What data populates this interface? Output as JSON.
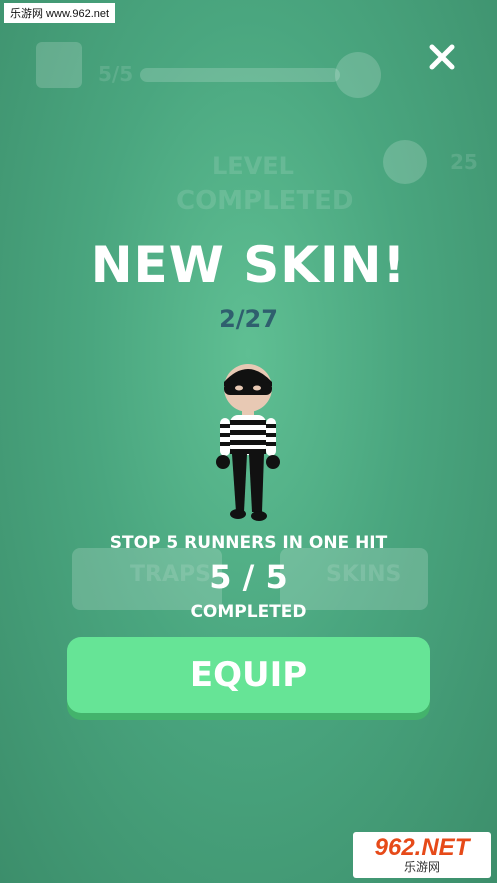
{
  "watermark_top": "乐游网 www.962.net",
  "background_hud": {
    "progress_text": "5/5",
    "level_line1": "LEVEL",
    "level_line2": "COMPLETED",
    "coins": "25",
    "traps_label": "TRAPS",
    "skins_label": "SKINS"
  },
  "modal": {
    "title": "NEW SKIN!",
    "counter": "2/27",
    "mission_text": "STOP 5 RUNNERS IN ONE HIT",
    "progress": "5 / 5",
    "status": "COMPLETED",
    "equip_label": "EQUIP"
  },
  "logo": {
    "main": "962.NET",
    "sub": "乐游网"
  },
  "colors": {
    "equip_button": "#66e496",
    "counter_text": "#2f5f6e"
  },
  "icons": [
    "close-icon",
    "gear-icon",
    "skull-icon",
    "coin-icon",
    "robber-skin-character"
  ]
}
